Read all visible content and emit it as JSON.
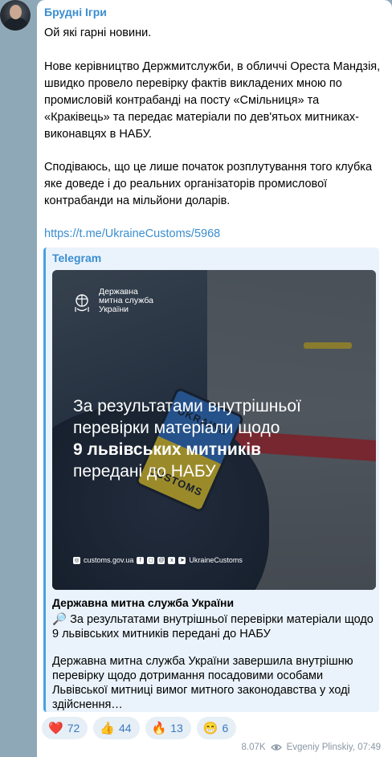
{
  "message": {
    "sender": "Брудні Ігри",
    "paragraphs": [
      "Ой які гарні новини.",
      "Нове керівництво Держмитслужби, в обличчі Ореста Мандзія, швидко провело перевірку фактів викладених мною по промисловій контрабанді на посту «Смільниця» та «Краківець» та передає матеріали по дев'ятьох митниках-виконавцях в НАБУ.",
      "Сподіваюсь, що це лише початок розплутування того клубка яке доведе і до реальних організаторів промислової контрабанди на мільйони доларів."
    ],
    "link": "https://t.me/UkraineCustoms/5968"
  },
  "preview": {
    "site_name": "Telegram",
    "image": {
      "logo_line1": "Державна",
      "logo_line2": "митна служба",
      "logo_line3": "України",
      "headline_line1": "За результатами внутрішньої",
      "headline_line2": "перевірки матеріали щодо",
      "headline_line3": "9 львівських митників",
      "headline_line4": "передані до НАБУ",
      "footer_site": "customs.gov.ua",
      "footer_handle": "UkraineCustoms",
      "patch_top": "UKRAINE",
      "patch_bottom": "CUSTOMS"
    },
    "title": "Державна митна служба України",
    "description_emoji": "🔎",
    "description_line1": "За результатами внутрішньої перевірки матеріали щодо",
    "description_line2": "9 львівських митників передані до НАБУ",
    "description_more": "Державна митна служба України завершила внутрішню перевірку щодо дотримання посадовими особами Львівської митниці вимог митного законодавства у ході здійснення…"
  },
  "reactions": [
    {
      "emoji": "❤️",
      "count": "72"
    },
    {
      "emoji": "👍",
      "count": "44"
    },
    {
      "emoji": "🔥",
      "count": "13"
    },
    {
      "emoji": "😁",
      "count": "6"
    }
  ],
  "meta": {
    "views": "8.07K",
    "author_time": "Evgeniy Plinskiy, 07:49"
  },
  "colors": {
    "link": "#3a8ed1",
    "accent_bar": "#4aa0e0",
    "preview_bg": "#eaf3fb",
    "reaction_bg": "#e6eef6"
  }
}
